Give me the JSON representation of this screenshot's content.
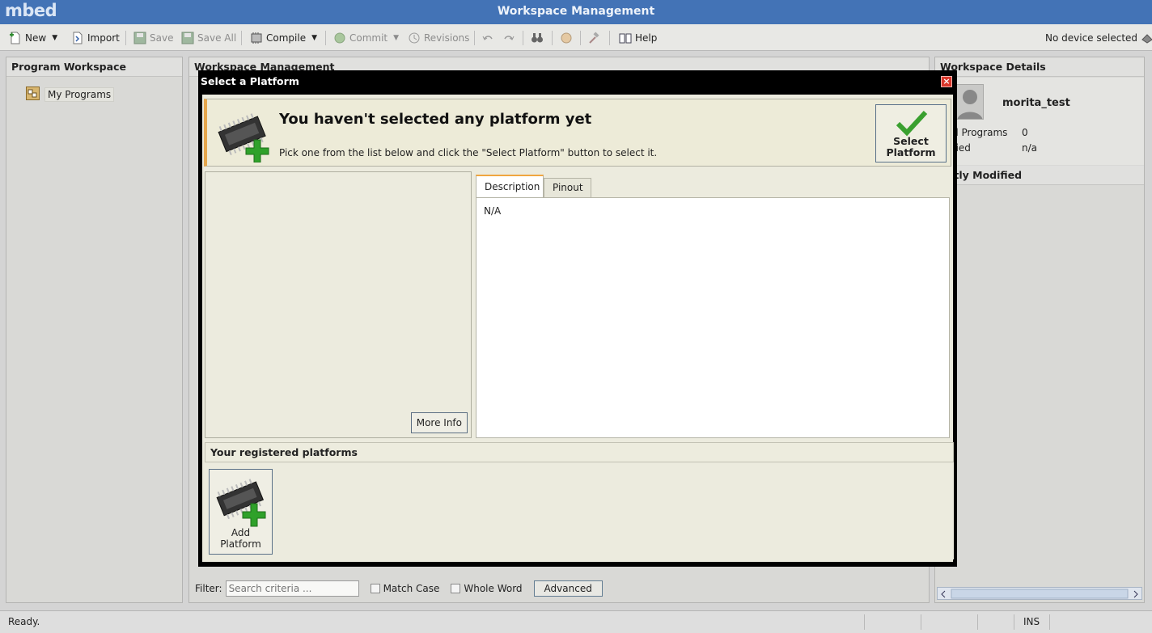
{
  "app": {
    "logo": "mbed",
    "title": "Workspace Management"
  },
  "toolbar": {
    "new": "New",
    "import": "Import",
    "save": "Save",
    "save_all": "Save All",
    "compile": "Compile",
    "commit": "Commit",
    "revisions": "Revisions",
    "help": "Help",
    "device_status": "No device selected"
  },
  "left_panel": {
    "header": "Program Workspace",
    "tree_item": "My Programs"
  },
  "center_panel": {
    "header": "Workspace Management"
  },
  "right_panel": {
    "header": "Workspace Details",
    "username": "morita_test",
    "rows": [
      {
        "label": "al Programs",
        "value": "0"
      },
      {
        "label": "ified",
        "value": "n/a"
      }
    ],
    "recent_header": "ently Modified"
  },
  "filter": {
    "label": "Filter:",
    "placeholder": "Search criteria ...",
    "match_case": "Match Case",
    "whole_word": "Whole Word",
    "advanced": "Advanced"
  },
  "status": {
    "text": "Ready.",
    "ins": "INS"
  },
  "dialog": {
    "title": "Select a Platform",
    "close": "×",
    "banner_title": "You haven't selected any platform yet",
    "banner_sub": "Pick one from the list below and click the \"Select Platform\" button to select it.",
    "select_button": "Select Platform",
    "more_info": "More Info",
    "tabs": [
      "Description",
      "Pinout"
    ],
    "description": "N/A",
    "registered_header": "Your registered platforms",
    "add_platform": "Add Platform"
  },
  "colors": {
    "title_bar": "#4373b6",
    "accent_tab": "#f0a640",
    "close_button": "#d9372b",
    "check_green": "#3aa02f"
  }
}
